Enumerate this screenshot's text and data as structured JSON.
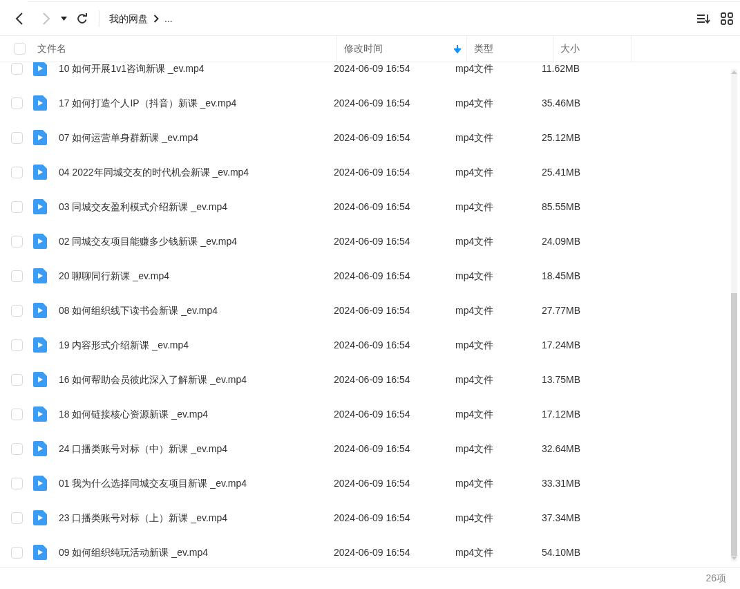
{
  "toolbar": {
    "back": {
      "disabled": false
    },
    "forward": {
      "disabled": true
    },
    "breadcrumb": [
      "我的网盘",
      "..."
    ]
  },
  "table": {
    "select_all": {
      "checked": false
    },
    "columns": [
      {
        "label": "文件名",
        "sorted": false
      },
      {
        "label": "修改时间",
        "sorted": true
      },
      {
        "label": "类型",
        "sorted": false
      },
      {
        "label": "大小",
        "sorted": false
      }
    ],
    "rows": [
      {
        "name": "10 如何开展1v1咨询新课 _ev.mp4",
        "modified": "2024-06-09 16:54",
        "type": "mp4文件",
        "size": "11.62MB",
        "checked": false
      },
      {
        "name": "17 如何打造个人IP（抖音）新课 _ev.mp4",
        "modified": "2024-06-09 16:54",
        "type": "mp4文件",
        "size": "35.46MB",
        "checked": false
      },
      {
        "name": "07 如何运营单身群新课 _ev.mp4",
        "modified": "2024-06-09 16:54",
        "type": "mp4文件",
        "size": "25.12MB",
        "checked": false
      },
      {
        "name": "04 2022年同城交友的时代机会新课 _ev.mp4",
        "modified": "2024-06-09 16:54",
        "type": "mp4文件",
        "size": "25.41MB",
        "checked": false
      },
      {
        "name": "03 同城交友盈利模式介绍新课 _ev.mp4",
        "modified": "2024-06-09 16:54",
        "type": "mp4文件",
        "size": "85.55MB",
        "checked": false
      },
      {
        "name": "02 同城交友项目能赚多少钱新课 _ev.mp4",
        "modified": "2024-06-09 16:54",
        "type": "mp4文件",
        "size": "24.09MB",
        "checked": false
      },
      {
        "name": "20 聊聊同行新课 _ev.mp4",
        "modified": "2024-06-09 16:54",
        "type": "mp4文件",
        "size": "18.45MB",
        "checked": false
      },
      {
        "name": "08 如何组织线下读书会新课 _ev.mp4",
        "modified": "2024-06-09 16:54",
        "type": "mp4文件",
        "size": "27.77MB",
        "checked": false
      },
      {
        "name": "19 内容形式介绍新课 _ev.mp4",
        "modified": "2024-06-09 16:54",
        "type": "mp4文件",
        "size": "17.24MB",
        "checked": false
      },
      {
        "name": "16 如何帮助会员彼此深入了解新课 _ev.mp4",
        "modified": "2024-06-09 16:54",
        "type": "mp4文件",
        "size": "13.75MB",
        "checked": false
      },
      {
        "name": "18 如何链接核心资源新课 _ev.mp4",
        "modified": "2024-06-09 16:54",
        "type": "mp4文件",
        "size": "17.12MB",
        "checked": false
      },
      {
        "name": "24 口播类账号对标（中）新课 _ev.mp4",
        "modified": "2024-06-09 16:54",
        "type": "mp4文件",
        "size": "32.64MB",
        "checked": false
      },
      {
        "name": "01 我为什么选择同城交友项目新课 _ev.mp4",
        "modified": "2024-06-09 16:54",
        "type": "mp4文件",
        "size": "33.31MB",
        "checked": false
      },
      {
        "name": "23 口播类账号对标（上）新课 _ev.mp4",
        "modified": "2024-06-09 16:54",
        "type": "mp4文件",
        "size": "37.34MB",
        "checked": false
      },
      {
        "name": "09 如何组织纯玩活动新课 _ev.mp4",
        "modified": "2024-06-09 16:54",
        "type": "mp4文件",
        "size": "54.10MB",
        "checked": false
      }
    ]
  },
  "status_bar": {
    "count": "26项"
  }
}
